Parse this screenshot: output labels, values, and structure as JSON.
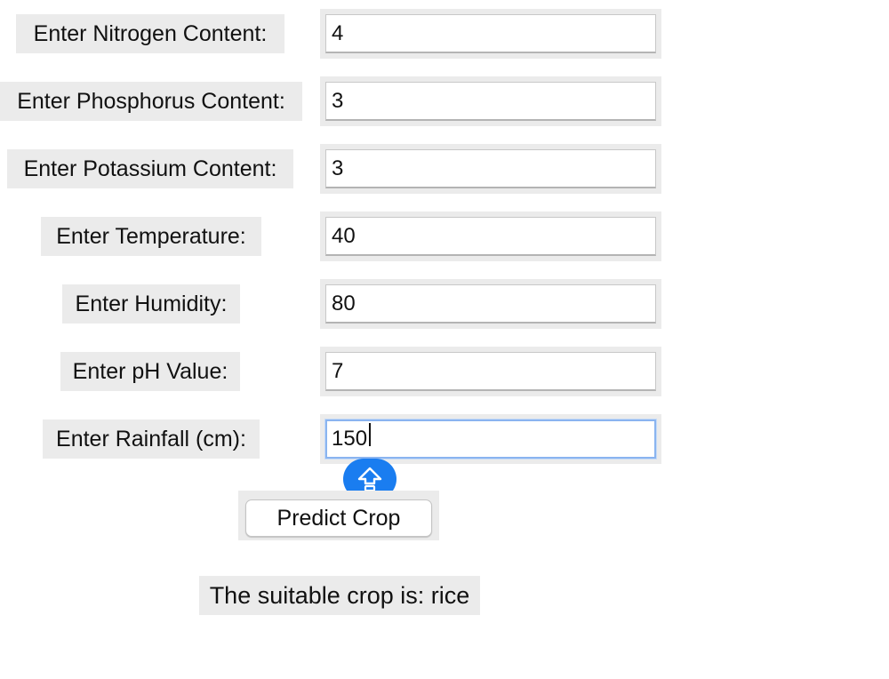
{
  "form": {
    "fields": [
      {
        "label": "Enter Nitrogen Content:",
        "value": "4"
      },
      {
        "label": "Enter Phosphorus Content:",
        "value": "3"
      },
      {
        "label": "Enter Potassium Content:",
        "value": "3"
      },
      {
        "label": "Enter Temperature:",
        "value": "40"
      },
      {
        "label": "Enter Humidity:",
        "value": "80"
      },
      {
        "label": "Enter pH Value:",
        "value": "7"
      },
      {
        "label": "Enter Rainfall (cm):",
        "value": "150"
      }
    ],
    "submit_label": "Predict Crop",
    "result_text": "The suitable crop is: rice"
  },
  "input_method_badge": {
    "icon": "shift-arrow-icon",
    "color": "#1a7df0"
  }
}
